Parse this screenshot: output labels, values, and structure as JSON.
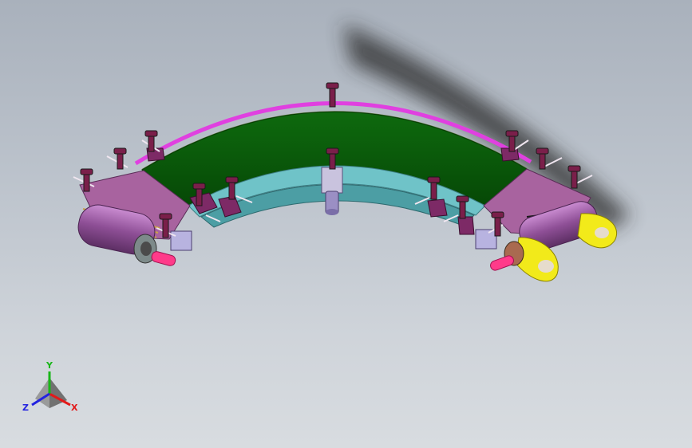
{
  "viewport": {
    "background_top": "#a9b1bc",
    "background_bottom": "#d8dce0"
  },
  "model": {
    "belt_color": "#0a5c0a",
    "frame_color": "#9a5aa0",
    "rail_color": "#e040e0",
    "inner_guard_color": "#6fc3c8",
    "drive_bracket_color": "#f2ea1a",
    "shaft_color": "#ff3b8a",
    "fastener_color": "#7a1f4a",
    "shadow_color": "#2a2a2a"
  },
  "triad": {
    "x_label": "X",
    "y_label": "Y",
    "z_label": "Z",
    "x_color": "#e21a1a",
    "y_color": "#19b619",
    "z_color": "#2323e0"
  }
}
